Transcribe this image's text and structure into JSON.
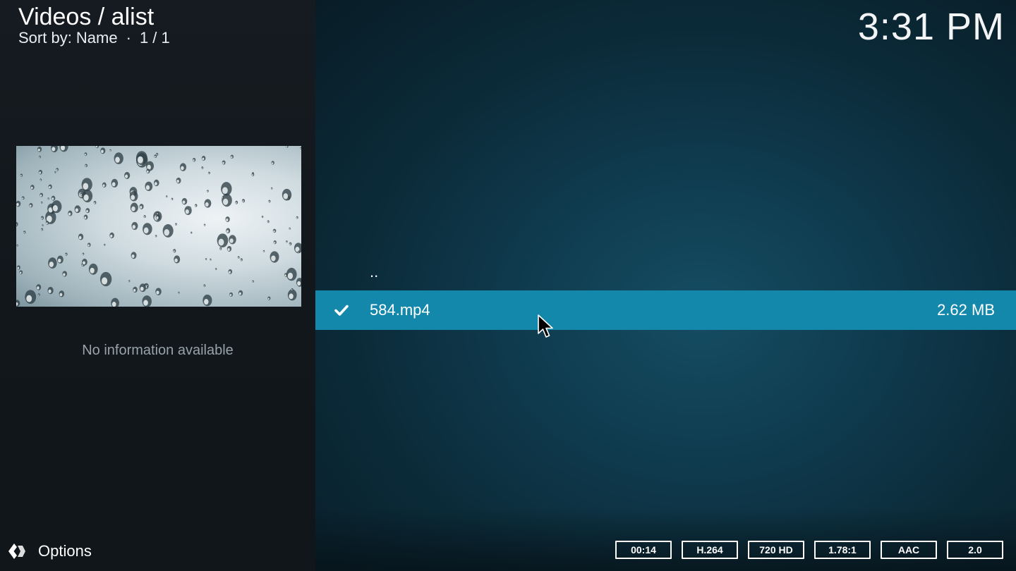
{
  "header": {
    "breadcrumb": "Videos / alist",
    "sort_label": "Sort by: Name",
    "separator": "·",
    "page_count": "1 / 1",
    "clock": "3:31 PM"
  },
  "info_panel": {
    "thumbnail_icon": "rain-drops-thumbnail",
    "no_info_text": "No information available"
  },
  "file_list": {
    "items": [
      {
        "name": "..",
        "size": ""
      },
      {
        "name": "584.mp4",
        "size": "2.62 MB",
        "watched": true
      }
    ],
    "selected_index": 1,
    "selected_color": "#1388aa"
  },
  "footer": {
    "options_label": "Options",
    "options_icon": "options-icon"
  },
  "media_flags": {
    "duration": "00:14",
    "video_codec": "H.264",
    "resolution": "720 HD",
    "aspect_ratio": "1.78:1",
    "audio_codec": "AAC",
    "audio_channels": "2.0"
  }
}
